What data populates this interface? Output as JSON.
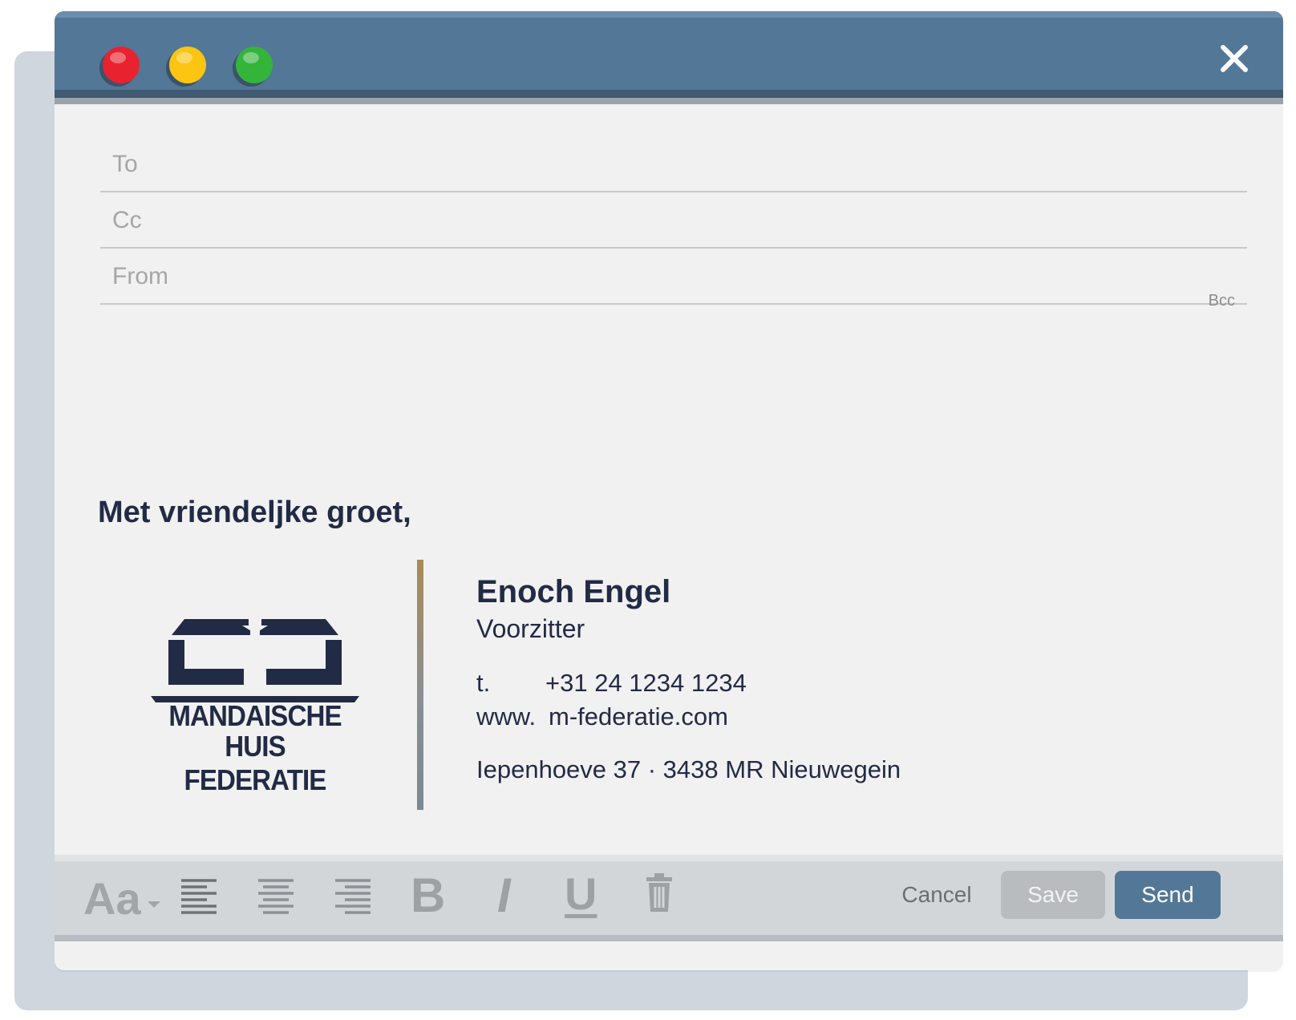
{
  "window": {
    "close_icon": "close-icon"
  },
  "fields": {
    "to_label": "To",
    "cc_label": "Cc",
    "from_label": "From",
    "bcc_label": "Bcc"
  },
  "body": {
    "greeting": "Met vriendeljke groet,"
  },
  "signature": {
    "logo_line1": "MANDAISCHE",
    "logo_line2": "HUIS FEDERATIE",
    "name": "Enoch Engel",
    "role": "Voorzitter",
    "phone_key": "t.",
    "phone": "+31 24 1234 1234",
    "web_key": "www.",
    "web": "m-federatie.com",
    "address": "Iepenhoeve 37 · 3438 MR  Nieuwegein"
  },
  "toolbar": {
    "font_label": "Aa",
    "bold_label": "B",
    "italic_label": "I",
    "underline_label": "U",
    "cancel_label": "Cancel",
    "save_label": "Save",
    "send_label": "Send"
  },
  "colors": {
    "titlebar": "#537796",
    "send_button": "#537796",
    "text_dark": "#222b45",
    "traffic_red": "#e8222f",
    "traffic_yellow": "#fbc512",
    "traffic_green": "#33b43b"
  }
}
